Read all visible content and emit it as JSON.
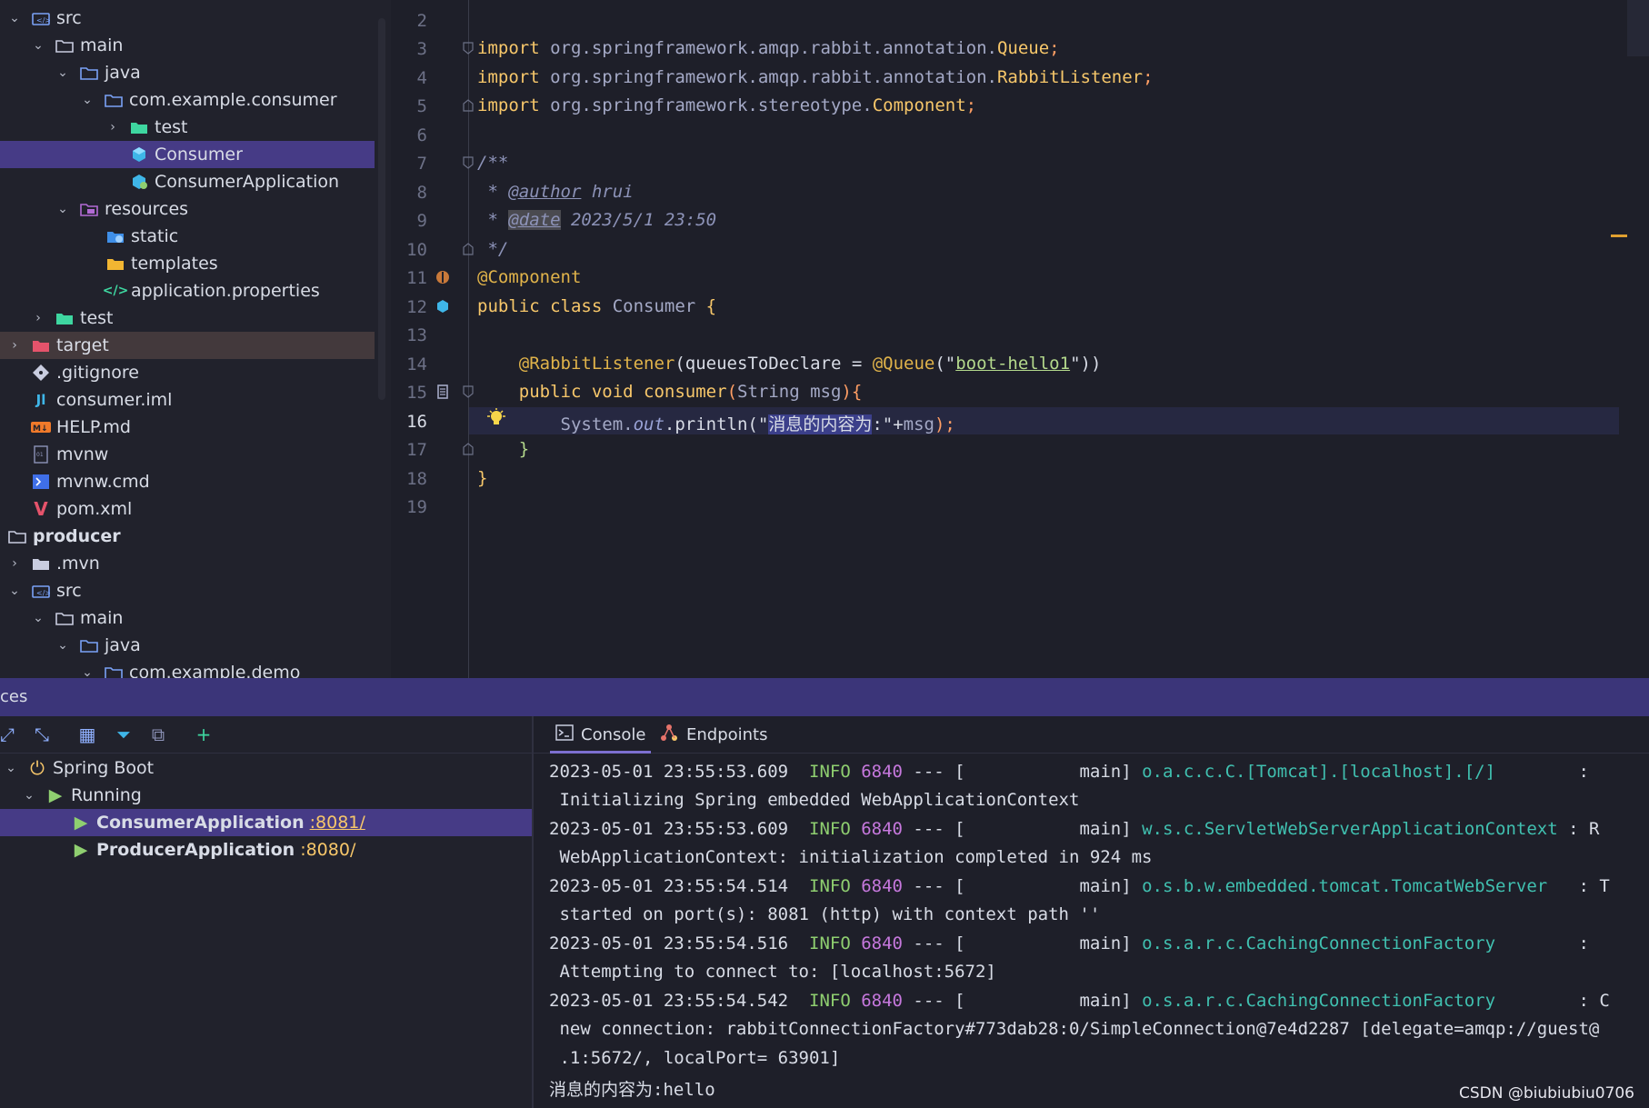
{
  "tree": {
    "rows": [
      {
        "label": "src",
        "icon": "source-folder-icon"
      },
      {
        "label": "main",
        "icon": "folder-icon"
      },
      {
        "label": "java",
        "icon": "source-root-icon"
      },
      {
        "label": "com.example.consumer",
        "icon": "package-icon"
      },
      {
        "label": "test",
        "icon": "test-folder-icon"
      },
      {
        "label": "Consumer",
        "icon": "java-class-icon"
      },
      {
        "label": "ConsumerApplication",
        "icon": "spring-app-icon"
      },
      {
        "label": "resources",
        "icon": "resources-folder-icon"
      },
      {
        "label": "static",
        "icon": "web-folder-icon"
      },
      {
        "label": "templates",
        "icon": "yellow-folder-icon"
      },
      {
        "label": "application.properties",
        "icon": "properties-file-icon"
      },
      {
        "label": "test",
        "icon": "test-folder-icon"
      },
      {
        "label": "target",
        "icon": "excluded-folder-icon"
      },
      {
        "label": ".gitignore",
        "icon": "git-icon"
      },
      {
        "label": "consumer.iml",
        "icon": "iml-file-icon"
      },
      {
        "label": "HELP.md",
        "icon": "markdown-file-icon"
      },
      {
        "label": "mvnw",
        "icon": "text-file-icon"
      },
      {
        "label": "mvnw.cmd",
        "icon": "script-file-icon"
      },
      {
        "label": "pom.xml",
        "icon": "maven-icon"
      },
      {
        "label": "producer",
        "icon": "module-folder-icon"
      },
      {
        "label": ".mvn",
        "icon": "folder-icon"
      },
      {
        "label": "src",
        "icon": "source-folder-icon"
      },
      {
        "label": "main",
        "icon": "folder-icon"
      },
      {
        "label": "java",
        "icon": "source-root-icon"
      },
      {
        "label": "com.example.demo",
        "icon": "package-icon"
      }
    ]
  },
  "editor": {
    "line_numbers": [
      "2",
      "3",
      "4",
      "5",
      "6",
      "7",
      "8",
      "9",
      "10",
      "11",
      "12",
      "13",
      "14",
      "15",
      "16",
      "17",
      "18",
      "19"
    ],
    "l3": {
      "kw": "import ",
      "pkg": "org.springframework.amqp.rabbit.annotation.",
      "cls": "Queue",
      "end": ";"
    },
    "l4": {
      "kw": "import ",
      "pkg": "org.springframework.amqp.rabbit.annotation.",
      "cls": "RabbitListener",
      "end": ";"
    },
    "l5": {
      "kw": "import ",
      "pkg": "org.springframework.stereotype.",
      "cls": "Component",
      "end": ";"
    },
    "l7": "/**",
    "l8": {
      "star": " * ",
      "tag": "@author",
      "val": " hrui"
    },
    "l9": {
      "star": " * ",
      "tag": "@date",
      "val": " 2023/5/1 23:50"
    },
    "l10": " */",
    "l11": "@Component",
    "l12": {
      "kw": "public class ",
      "cls": "Consumer ",
      "brace": "{"
    },
    "l14": {
      "ann": "@RabbitListener",
      "p1": "(queuesToDeclare = ",
      "ann2": "@Queue",
      "p2": "(\"",
      "str": "boot-hello1",
      "p3": "\"))"
    },
    "l15": {
      "kw": "public void ",
      "name": "consumer",
      "p1": "(",
      "type": "String ",
      "arg": "msg",
      "p2": "){"
    },
    "l16": {
      "a": "System.",
      "b": "out",
      "c": ".println(\"",
      "str": "消息的内容为",
      "d": ":\"+",
      "e": "msg",
      "f": ");"
    },
    "l17": "}",
    "l18": "}"
  },
  "services": {
    "header": "ces",
    "spring_boot": "Spring Boot",
    "running": "Running",
    "apps": [
      {
        "name": "ConsumerApplication",
        "port": ":8081/"
      },
      {
        "name": "ProducerApplication",
        "port": ":8080/"
      }
    ]
  },
  "console": {
    "tab_console": "Console",
    "tab_endpoints": "Endpoints",
    "logs": [
      {
        "ts": "2023-05-01 23:55:53.609",
        "lvl": "INFO",
        "pid": "6840",
        "mid": " --- [           main] ",
        "logger": "o.a.c.c.C.[Tomcat].[localhost].[/]       ",
        "tail": ":",
        "msg": " Initializing Spring embedded WebApplicationContext"
      },
      {
        "ts": "2023-05-01 23:55:53.609",
        "lvl": "INFO",
        "pid": "6840",
        "mid": " --- [           main] ",
        "logger": "w.s.c.ServletWebServerApplicationContext ",
        "tail": ": R",
        "msg": " WebApplicationContext: initialization completed in 924 ms"
      },
      {
        "ts": "2023-05-01 23:55:54.514",
        "lvl": "INFO",
        "pid": "6840",
        "mid": " --- [           main] ",
        "logger": "o.s.b.w.embedded.tomcat.TomcatWebServer  ",
        "tail": ": T",
        "msg": " started on port(s): 8081 (http) with context path ''"
      },
      {
        "ts": "2023-05-01 23:55:54.516",
        "lvl": "INFO",
        "pid": "6840",
        "mid": " --- [           main] ",
        "logger": "o.s.a.r.c.CachingConnectionFactory       ",
        "tail": ":",
        "msg": " Attempting to connect to: [localhost:5672]"
      },
      {
        "ts": "2023-05-01 23:55:54.542",
        "lvl": "INFO",
        "pid": "6840",
        "mid": " --- [           main] ",
        "logger": "o.s.a.r.c.CachingConnectionFactory       ",
        "tail": ": C",
        "msg": " new connection: rabbitConnectionFactory#773dab28:0/SimpleConnection@7e4d2287 [delegate=amqp://guest@"
      }
    ],
    "cont": " .1:5672/, localPort= 63901]",
    "output": "消息的内容为:hello"
  },
  "watermark": "CSDN @biubiubiu0706",
  "colors": {
    "selection": "#463b86",
    "accent": "#7c6fd0"
  }
}
